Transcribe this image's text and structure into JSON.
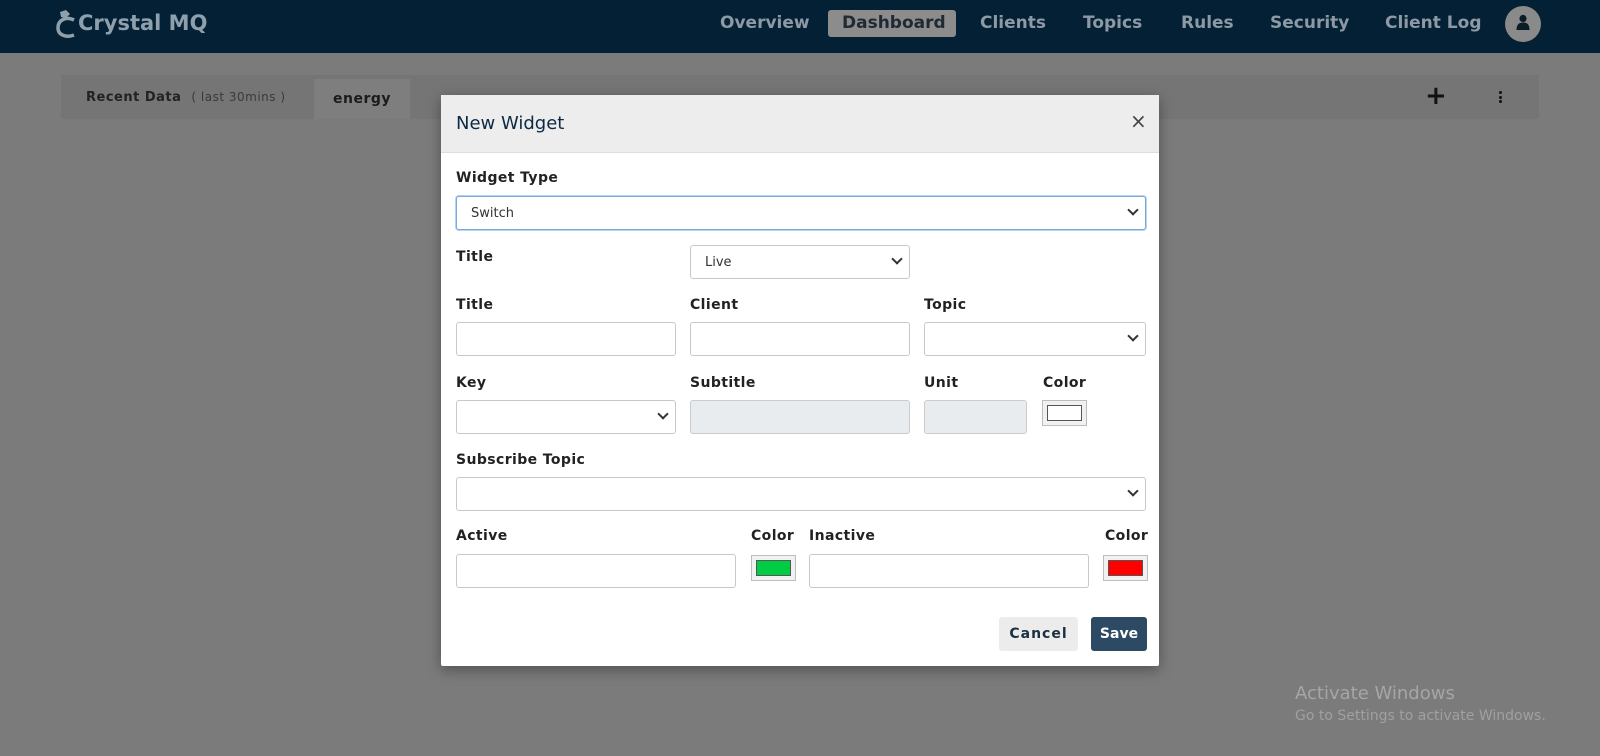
{
  "app": {
    "logo_text": "Crystal MQ"
  },
  "nav": {
    "items": [
      {
        "label": "Overview",
        "active": false
      },
      {
        "label": "Dashboard",
        "active": true
      },
      {
        "label": "Clients",
        "active": false
      },
      {
        "label": "Topics",
        "active": false
      },
      {
        "label": "Rules",
        "active": false
      },
      {
        "label": "Security",
        "active": false
      },
      {
        "label": "Client Log",
        "active": false
      }
    ]
  },
  "tabbar": {
    "recent_label": "Recent Data",
    "recent_sub": "( last 30mins )",
    "active_tab": "energy"
  },
  "modal": {
    "title": "New Widget",
    "close_icon": "×",
    "widget_type_label": "Widget Type",
    "widget_type_value": "Switch",
    "title_label": "Title",
    "mode_value": "Live",
    "title_field_label": "Title",
    "title_value": "",
    "client_label": "Client",
    "client_value": "",
    "topic_label": "Topic",
    "topic_value": "",
    "key_label": "Key",
    "key_value": "",
    "subtitle_label": "Subtitle",
    "subtitle_value": "",
    "unit_label": "Unit",
    "unit_value": "",
    "color_label": "Color",
    "color_value": "#ffffff",
    "subscribe_topic_label": "Subscribe Topic",
    "subscribe_topic_value": "",
    "active_label": "Active",
    "active_value": "",
    "active_color_label": "Color",
    "active_color": "#00cc44",
    "inactive_label": "Inactive",
    "inactive_value": "",
    "inactive_color_label": "Color",
    "inactive_color": "#ff0000",
    "cancel_label": "Cancel",
    "save_label": "Save"
  },
  "watermark": {
    "title": "Activate Windows",
    "subtitle": "Go to Settings to activate Windows."
  },
  "icons": {
    "logo": "crystal-logo-icon",
    "avatar": "user-icon",
    "add": "plus-icon",
    "menu": "kebab-icon"
  }
}
